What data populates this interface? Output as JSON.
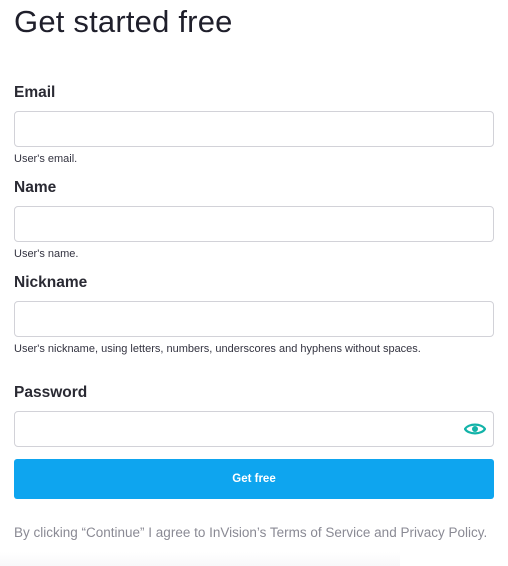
{
  "page": {
    "title": "Get started free"
  },
  "form": {
    "email": {
      "label": "Email",
      "value": "",
      "help": "User's email."
    },
    "name": {
      "label": "Name",
      "value": "",
      "help": "User's name."
    },
    "nickname": {
      "label": "Nickname",
      "value": "",
      "help": "User's nickname, using letters, numbers, underscores and hyphens without spaces."
    },
    "password": {
      "label": "Password",
      "value": "",
      "toggle_icon": "eye-icon"
    },
    "submit_label": "Get free"
  },
  "legal": {
    "prefix": "By clicking “Continue” I agree to InVision’s ",
    "terms_link": "Terms of Service",
    "middle": " and ",
    "privacy_link": "Privacy Policy",
    "suffix": "."
  },
  "colors": {
    "accent": "#0ea5ef",
    "toggle_icon": "#12b3a8"
  }
}
